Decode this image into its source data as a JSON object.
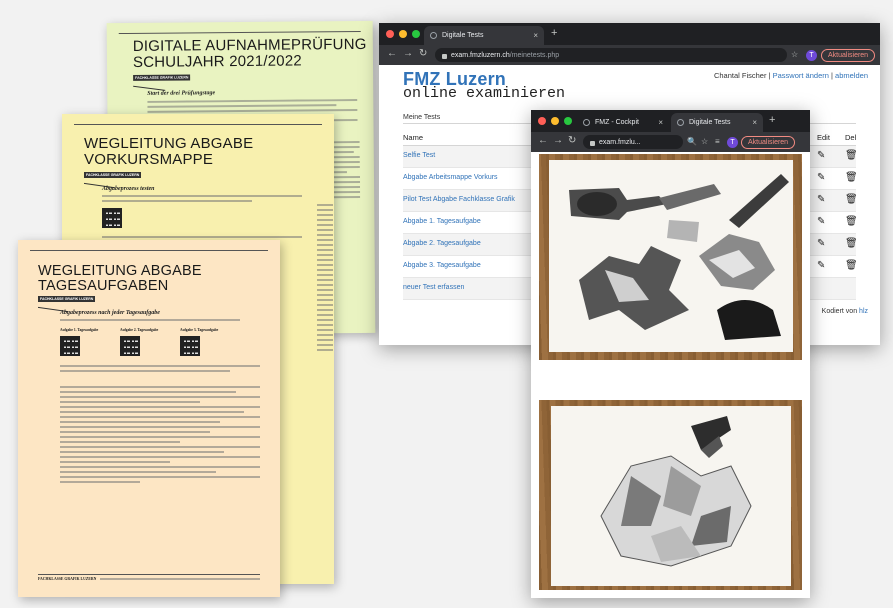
{
  "documents": {
    "green": {
      "title": "DIGITALE AUFNAHMEPRÜFUNG\nSCHULJAHR 2021/2022",
      "tag": "FACHKLASSE GRAFIK LUZERN",
      "subtitle": "Start der drei Prüfungstage"
    },
    "yellow": {
      "title": "WEGLEITUNG ABGABE\nVORKURSMAPPE",
      "tag": "FACHKLASSE GRAFIK LUZERN",
      "subtitle": "Abgabeprozess testen"
    },
    "peach": {
      "title": "WEGLEITUNG ABGABE\nTAGESAUFGABEN",
      "tag": "FACHKLASSE GRAFIK LUZERN",
      "subtitle": "Abgabeprozess nach jeder Tagesaufgabe",
      "qr_labels": [
        "Aufgabe 1. Tagesaufgabe",
        "Aufgabe 2. Tagesaufgabe",
        "Aufgabe 3. Tagesaufgabe"
      ],
      "footer": "FACHKLASSE GRAFIK LUZERN"
    }
  },
  "main_window": {
    "tab_title": "Digitale Tests",
    "url_host": "exam.fmzluzern.ch",
    "url_path": "/meinetests.php",
    "avatar_letter": "T",
    "update_label": "Aktualisieren",
    "logo": "FMZ Luzern",
    "logo_sub": "online examinieren",
    "user_name": "Chantal Fischer",
    "user_sep1": "|",
    "link_password": "Passwort ändern",
    "user_sep2": "|",
    "link_logout": "abmelden",
    "section_title": "Meine Tests",
    "col_name": "Name",
    "col_edit": "Edit",
    "col_del": "Del",
    "rows": [
      {
        "name": "Selfie Test"
      },
      {
        "name": "Abgabe Arbeitsmappe Vorkurs"
      },
      {
        "name": "Pilot Test Abgabe Fachklasse Grafik"
      },
      {
        "name": "Abgabe 1. Tagesaufgabe"
      },
      {
        "name": "Abgabe 2. Tagesaufgabe"
      },
      {
        "name": "Abgabe 3. Tagesaufgabe"
      }
    ],
    "new_test": "neuer Test erfassen",
    "coded_by": "Kodiert von",
    "coded_link": "hlz"
  },
  "front_window": {
    "tab1_title": "FMZ - Cockpit",
    "tab2_title": "Digitale Tests",
    "url": "exam.fmzlu...",
    "avatar_letter": "T",
    "update_label": "Aktualisieren"
  },
  "icons": {
    "edit": "pencil-icon",
    "delete": "trash-icon"
  }
}
